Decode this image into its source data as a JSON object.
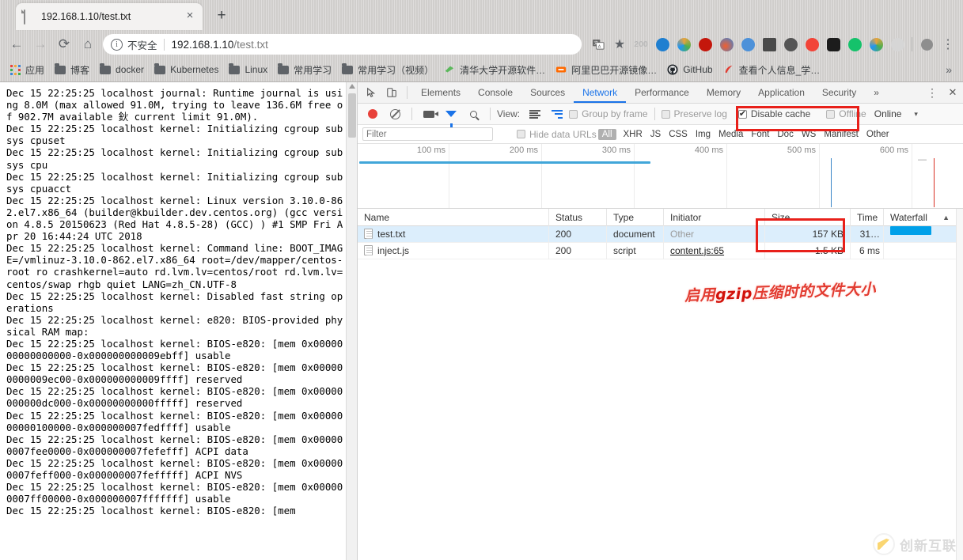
{
  "browser": {
    "tab": {
      "title": "192.168.1.10/test.txt",
      "favicon_icon": "document-icon",
      "close_icon": "×"
    },
    "new_tab_label": "+",
    "nav": {
      "back_icon": "←",
      "forward_icon": "→",
      "reload_icon": "⟳",
      "home_icon": "⌂"
    },
    "omnibox": {
      "info_icon": "i",
      "security_label": "不安全",
      "url_host": "192.168.1.10",
      "url_path": "/test.txt",
      "translate_icon": "translate-icon",
      "bookmark_icon": "★"
    },
    "toolbar_badge": "200",
    "extensions": [
      {
        "name": "ip-extension",
        "color": "#1f7fd0"
      },
      {
        "name": "color-wheel-extension",
        "color": "#e8a33d"
      },
      {
        "name": "adblock-plus-extension",
        "color": "#c4170c"
      },
      {
        "name": "flame-extension",
        "color": "#3b86d8"
      },
      {
        "name": "translate-extension",
        "color": "#4d91d9"
      },
      {
        "name": "portrait-extension",
        "color": "#4a4a4a"
      },
      {
        "name": "spiral-extension",
        "color": "#555555"
      },
      {
        "name": "infinity-extension",
        "color": "#f24438"
      },
      {
        "name": "eyes-extension",
        "color": "#1c1c1c"
      },
      {
        "name": "grammarly-extension",
        "color": "#15c26b"
      },
      {
        "name": "chrome-extension",
        "color": "#e8a33d"
      },
      {
        "name": "m-extension",
        "color": "#c0c0c0"
      }
    ],
    "profile_icon": "avatar-icon",
    "menu_icon": "⋮",
    "bookmarks": [
      {
        "label": "应用",
        "icon": "apps-grid-icon"
      },
      {
        "label": "博客",
        "icon": "folder-icon"
      },
      {
        "label": "docker",
        "icon": "folder-icon"
      },
      {
        "label": "Kubernetes",
        "icon": "folder-icon"
      },
      {
        "label": "Linux",
        "icon": "folder-icon"
      },
      {
        "label": "常用学习",
        "icon": "folder-icon"
      },
      {
        "label": "常用学习（视频）",
        "icon": "folder-icon"
      },
      {
        "label": "清华大学开源软件…",
        "icon": "tsinghua-icon"
      },
      {
        "label": "阿里巴巴开源镜像…",
        "icon": "aliyun-icon"
      },
      {
        "label": "GitHub",
        "icon": "github-icon"
      },
      {
        "label": "查看个人信息_学…",
        "icon": "feather-icon"
      }
    ],
    "bookmarks_overflow": "»"
  },
  "page": {
    "text": "Dec 15 22:25:25 localhost journal: Runtime journal is using 8.0M (max allowed 91.0M, trying to leave 136.6M free of 902.7M available 鈥 current limit 91.0M).\nDec 15 22:25:25 localhost kernel: Initializing cgroup subsys cpuset\nDec 15 22:25:25 localhost kernel: Initializing cgroup subsys cpu\nDec 15 22:25:25 localhost kernel: Initializing cgroup subsys cpuacct\nDec 15 22:25:25 localhost kernel: Linux version 3.10.0-862.el7.x86_64 (builder@kbuilder.dev.centos.org) (gcc version 4.8.5 20150623 (Red Hat 4.8.5-28) (GCC) ) #1 SMP Fri Apr 20 16:44:24 UTC 2018\nDec 15 22:25:25 localhost kernel: Command line: BOOT_IMAGE=/vmlinuz-3.10.0-862.el7.x86_64 root=/dev/mapper/centos-root ro crashkernel=auto rd.lvm.lv=centos/root rd.lvm.lv=centos/swap rhgb quiet LANG=zh_CN.UTF-8\nDec 15 22:25:25 localhost kernel: Disabled fast string operations\nDec 15 22:25:25 localhost kernel: e820: BIOS-provided physical RAM map:\nDec 15 22:25:25 localhost kernel: BIOS-e820: [mem 0x0000000000000000-0x000000000009ebff] usable\nDec 15 22:25:25 localhost kernel: BIOS-e820: [mem 0x000000000009ec00-0x000000000009ffff] reserved\nDec 15 22:25:25 localhost kernel: BIOS-e820: [mem 0x00000000000dc000-0x00000000000fffff] reserved\nDec 15 22:25:25 localhost kernel: BIOS-e820: [mem 0x0000000000100000-0x000000007fedffff] usable\nDec 15 22:25:25 localhost kernel: BIOS-e820: [mem 0x000000007fee0000-0x000000007fefefff] ACPI data\nDec 15 22:25:25 localhost kernel: BIOS-e820: [mem 0x000000007feff000-0x000000007fefffff] ACPI NVS\nDec 15 22:25:25 localhost kernel: BIOS-e820: [mem 0x000000007ff00000-0x000000007fffffff] usable\nDec 15 22:25:25 localhost kernel: BIOS-e820: [mem"
  },
  "devtools": {
    "inspect_icon": "inspect-icon",
    "device_icon": "device-toolbar-icon",
    "tabs": [
      {
        "label": "Elements",
        "active": false
      },
      {
        "label": "Console",
        "active": false
      },
      {
        "label": "Sources",
        "active": false
      },
      {
        "label": "Network",
        "active": true
      },
      {
        "label": "Performance",
        "active": false
      },
      {
        "label": "Memory",
        "active": false
      },
      {
        "label": "Application",
        "active": false
      },
      {
        "label": "Security",
        "active": false
      }
    ],
    "tabs_overflow": "»",
    "more_icon": "⋮",
    "close_icon": "✕",
    "toolbar": {
      "record_icon": "record-icon",
      "clear_icon": "clear-icon",
      "capture_screenshots_icon": "camera-icon",
      "filter_icon": "funnel-icon",
      "search_icon": "search-icon",
      "view_label": "View:",
      "view_list_icon": "list-view-icon",
      "view_waterfall_icon": "waterfall-view-icon",
      "group_by_frame": "Group by frame",
      "preserve_log": "Preserve log",
      "disable_cache": "Disable cache",
      "disable_cache_checked": true,
      "offline": "Offline",
      "throttling": "Online",
      "throttling_caret": "▾"
    },
    "filterbar": {
      "filter_placeholder": "Filter",
      "filter_value": "",
      "hide_data_urls": "Hide data URLs",
      "types": [
        "All",
        "XHR",
        "JS",
        "CSS",
        "Img",
        "Media",
        "Font",
        "Doc",
        "WS",
        "Manifest",
        "Other"
      ],
      "active_type": "All"
    },
    "overview": {
      "ticks": [
        "100 ms",
        "200 ms",
        "300 ms",
        "400 ms",
        "500 ms",
        "600 ms"
      ],
      "dash_label": "—"
    },
    "table": {
      "columns": [
        "Name",
        "Status",
        "Type",
        "Initiator",
        "Size",
        "Time",
        "Waterfall"
      ],
      "sort_caret": "▲",
      "rows": [
        {
          "name": "test.txt",
          "status": "200",
          "type": "document",
          "initiator": "Other",
          "initiator_link": false,
          "size": "157 KB",
          "time": "31…",
          "selected": true
        },
        {
          "name": "inject.js",
          "status": "200",
          "type": "script",
          "initiator": "content.js:65",
          "initiator_link": true,
          "size": "1.5 KB",
          "time": "6 ms",
          "selected": false
        }
      ]
    }
  },
  "annotations": {
    "gzip_note_prefix": "启用",
    "gzip_note_highlight": "gzip",
    "gzip_note_suffix": "压缩时的文件大小",
    "gzip_note_full": "启用gzip压缩时的文件大小"
  },
  "watermark": {
    "text": "创新互联",
    "logo_icon": "chuangxin-logo-icon"
  },
  "colors": {
    "accent": "#1a73e8",
    "annotation_red": "#e8201a",
    "waterfall_blue": "#00a0e9",
    "record_red": "#e8413a",
    "selected_row": "#dceefc"
  }
}
